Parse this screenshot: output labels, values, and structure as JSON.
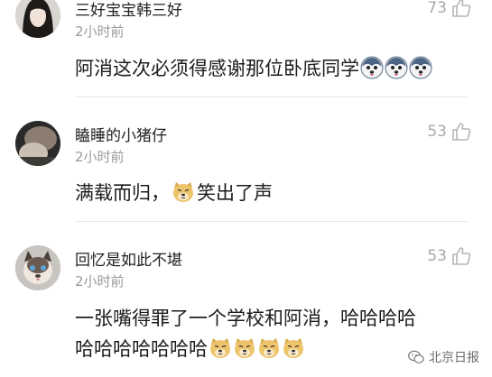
{
  "comments": [
    {
      "username": "三好宝宝韩三好",
      "time": "2小时前",
      "likes": "73",
      "content": "阿消这次必须得感谢那位卧底同学",
      "emoji": "husky-face-icon"
    },
    {
      "username": "瞌睡的小猪仔",
      "time": "2小时前",
      "likes": "53",
      "content_before": "满载而归，",
      "content_after": "笑出了声",
      "emoji": "doge-face-icon"
    },
    {
      "username": "回忆是如此不堪",
      "time": "2小时前",
      "likes": "53",
      "content_line1": "一张嘴得罪了一个学校和阿消，哈哈哈哈",
      "content_line2": "哈哈哈哈哈哈哈",
      "emoji": "doge-face-icon"
    }
  ],
  "watermark": {
    "text": "北京日报",
    "icon": "wechat-icon"
  }
}
